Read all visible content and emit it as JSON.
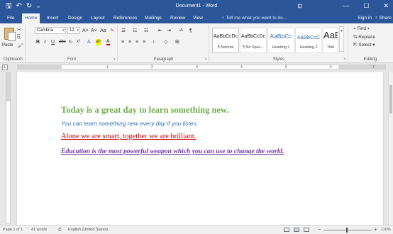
{
  "window": {
    "title": "Document1 - Word",
    "qat": {
      "save": "🖫",
      "undo": "↶",
      "redo": "↻",
      "customize": "₌"
    },
    "ribbon_options_icon": "⊡",
    "controls": {
      "minimize": "—",
      "restore": "☐",
      "close": "✕"
    }
  },
  "tabs": [
    "File",
    "Home",
    "Insert",
    "Design",
    "Layout",
    "References",
    "Mailings",
    "Review",
    "View"
  ],
  "active_tab": "Home",
  "tell_me": "♀ Tell me what you want to do...",
  "account": {
    "sign_in": "Sign in",
    "share": "♀ Share"
  },
  "ribbon": {
    "clipboard": {
      "label": "Clipboard",
      "paste_label": "Paste",
      "cut_icon": "✂",
      "copy_icon": "⎘",
      "painter_icon": "🖌"
    },
    "font": {
      "label": "Font",
      "name": "Cambria",
      "size": "12",
      "grow": "A˄",
      "shrink": "A˅",
      "case": "Aa",
      "clear": "✎",
      "bold": "B",
      "italic": "I",
      "underline": "U",
      "strike": "abc",
      "subscript": "x₂",
      "superscript": "x²",
      "effects": "A",
      "highlight": "ab",
      "color": "A"
    },
    "paragraph": {
      "label": "Paragraph",
      "bullets": "☰",
      "numbering": "☷",
      "multilevel": "☵",
      "decrease_indent": "⇤",
      "increase_indent": "⇥",
      "sort": "↓A",
      "show_marks": "¶",
      "align_left": "≡",
      "align_center": "≡",
      "align_right": "≡",
      "justify": "≡",
      "line_spacing": "↕",
      "shading": "◇",
      "borders": "⊞"
    },
    "styles": {
      "label": "Styles",
      "items": [
        {
          "preview": "AaBbCcDc",
          "name": "¶ Normal"
        },
        {
          "preview": "AaBbCcDc",
          "name": "¶ No Spac..."
        },
        {
          "preview": "AaBbCc",
          "name": "Heading 1"
        },
        {
          "preview": "AaBbCcC",
          "name": "Heading 2"
        },
        {
          "preview": "AaB",
          "name": "Title"
        }
      ],
      "more": "▾"
    },
    "editing": {
      "label": "Editing",
      "find": "⌕ Find ▾",
      "replace": "⇆ Replace",
      "select": "⇱ Select ▾"
    }
  },
  "ruler": {
    "numbers": [
      "1",
      "2",
      "3",
      "4",
      "5",
      "6",
      "7"
    ],
    "tab_selector": "L"
  },
  "document": {
    "lines": [
      "Today is a great day to learn something new.",
      "You can learn something new every day if you listen.",
      "Alone we are smart, together we are brilliant.",
      "Education is the most powerful weapon which you can use to change the world."
    ]
  },
  "status": {
    "page": "Page 1 of 1",
    "words": "41 words",
    "proofing_icon": "⎙",
    "language": "English (United States)",
    "zoom": "110%",
    "zoom_out": "−",
    "zoom_in": "+"
  }
}
